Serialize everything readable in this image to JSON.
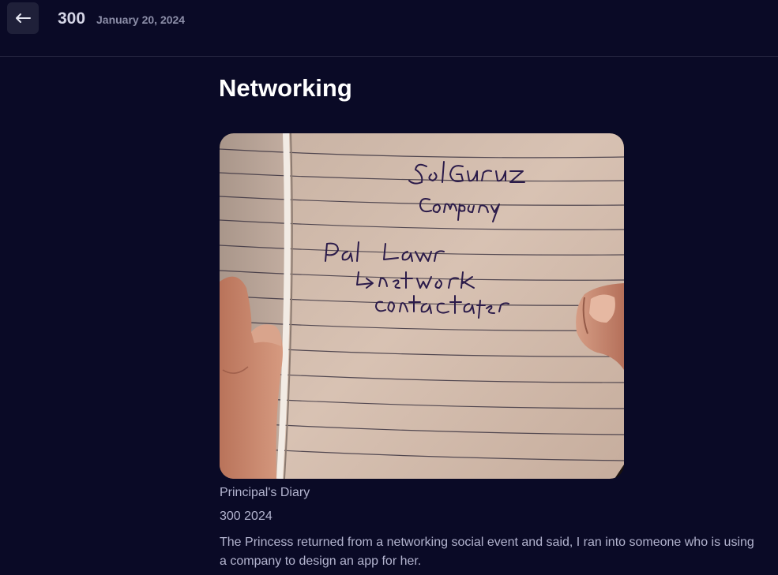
{
  "header": {
    "back_icon": "arrow-left-icon",
    "entry_number": "300",
    "entry_date": "January 20, 2024"
  },
  "entry": {
    "title": "Networking",
    "photo": {
      "handwriting": [
        "SolGuruz",
        "Company",
        "Paul Lawr",
        "↳ network",
        "contact after"
      ]
    },
    "diary_label": "Principal's Diary",
    "year_line": "300 2024",
    "description": "The Princess returned from a networking social event and said, I ran into someone who is using a company to design an app for her."
  },
  "colors": {
    "background": "#0a0a26",
    "button_bg": "#1f2039",
    "text_muted": "#b3b4cf",
    "ink": "#2b1b4a"
  }
}
